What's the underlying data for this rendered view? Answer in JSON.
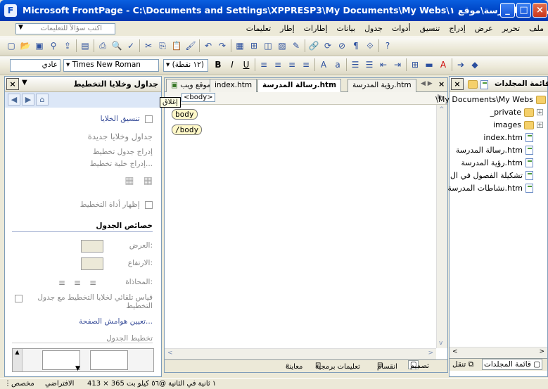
{
  "window": {
    "title": "Microsoft FrontPage - C:\\Documents and Settings\\XPPRESP3\\My Documents\\My Webs\\رسالة المدرسة\\موقع ١.htm",
    "minimize": "_",
    "maximize": "□",
    "close": "×"
  },
  "menubar": {
    "help_placeholder": "اكتب سؤالاً للتعليمات",
    "items": [
      "ملف",
      "تحرير",
      "عرض",
      "إدراج",
      "تنسيق",
      "أدوات",
      "جدول",
      "بيانات",
      "إطارات",
      "إطار",
      "تعليمات"
    ]
  },
  "format_toolbar": {
    "style": "عادي",
    "font": "Times New Roman",
    "size": "(١٢ نقطة)"
  },
  "left_panel": {
    "title": "جداول وخلايا التخطيط",
    "close": "×",
    "link_cell_formatting": "تنسيق الخلايا",
    "section_new": "جداول وخلايا جديدة",
    "insert_table": "إدراج جدول تخطيط",
    "insert_cell": "إدراج خلية تخطيط...",
    "show_tool": "إظهار أداة التخطيط",
    "section_props": "خصائص الجدول",
    "width_label": "العرض:",
    "height_label": "الارتفاع:",
    "align_label": "المحاذاة:",
    "autoscale": "قياس تلقائي لخلايا التخطيط مع جدول التخطيط",
    "set_margins": "تعيين هوامش الصفحة...",
    "section_layout": "تخطيط الجدول"
  },
  "editor": {
    "tabs": [
      "موقع ويب",
      "index.htm",
      "رسالة المدرسة.htm",
      "رؤية المدرسة.htm"
    ],
    "active_tab": 2,
    "tag_selector": "<body>",
    "tooltip": "إغلاق",
    "tag_open": "body",
    "tag_close": "/body",
    "view_design": "تصميم",
    "view_split": "انقسام",
    "view_code": "تعليمات برمجية",
    "view_preview": "معاينة"
  },
  "right_panel": {
    "title": "قائمة المجلدات",
    "close": "×",
    "root": "\\My Documents\\My Webs",
    "items": [
      {
        "name": "_private",
        "type": "folder",
        "expandable": true
      },
      {
        "name": "images",
        "type": "folder",
        "expandable": true
      },
      {
        "name": "index.htm",
        "type": "page",
        "expandable": false
      },
      {
        "name": "رسالة المدرسة.htm",
        "type": "page",
        "expandable": false
      },
      {
        "name": "رؤية المدرسة.htm",
        "type": "page",
        "expandable": false
      },
      {
        "name": "تشكيلة الفصول في ال",
        "type": "page",
        "expandable": false
      },
      {
        "name": "نشاطات المدرسة.htm",
        "type": "page",
        "expandable": false
      }
    ],
    "tab_folders": "قائمة المجلدات",
    "tab_nav": "تنقل"
  },
  "statusbar": {
    "download": "١ ثانية في الثانية @٥٦ كيلو بت",
    "dimensions": "413 × 365",
    "default": "الافتراضي",
    "custom": "مخصص"
  },
  "colors": {
    "titlebar": "#0A5FE0",
    "chrome": "#ECE9D8",
    "panel_border": "#7F9DB9",
    "link_blue": "#3A4F9A"
  }
}
